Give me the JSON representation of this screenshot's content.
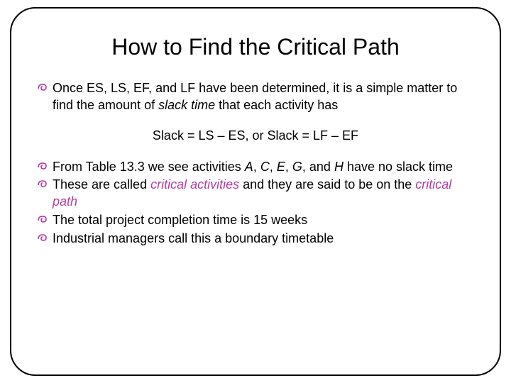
{
  "title": "How to Find the Critical Path",
  "bullet1": {
    "pre": "Once ES, LS, EF, and LF have been determined, it is a simple matter to find the amount of ",
    "em": "slack time",
    "post": " that each activity has"
  },
  "formula": "Slack = LS – ES,  or  Slack = LF – EF",
  "bullet2": {
    "pre": "From Table 13.3 we see activities ",
    "a": "A",
    "c1": ", ",
    "c": "C",
    "c2": ", ",
    "e": "E",
    "c3": ", ",
    "g": "G",
    "c4": ", and ",
    "h": "H",
    "post": " have no slack time"
  },
  "bullet3": {
    "pre": "These are called ",
    "em1": "critical activities",
    "mid": " and they are said to be on the ",
    "em2": "critical path"
  },
  "bullet4": "The total project completion time is 15 weeks",
  "bullet5": "Industrial managers call this a boundary timetable"
}
